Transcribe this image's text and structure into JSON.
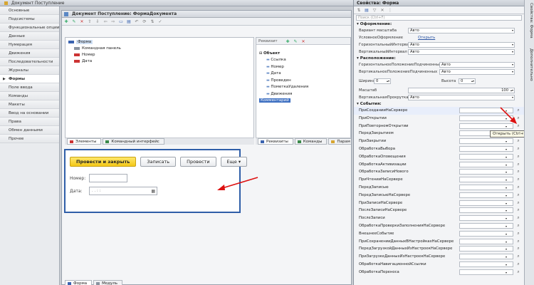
{
  "window_title": "Документ Поступление",
  "nav_items": [
    "Основные",
    "Подсистемы",
    "Функциональные опции",
    "Данные",
    "Нумерация",
    "Движения",
    "Последовательности",
    "Журналы",
    "Формы",
    "Поле ввода",
    "Команды",
    "Макеты",
    "Ввод на основании",
    "Права",
    "Обмен данными",
    "Прочее"
  ],
  "nav_active_index": 8,
  "doc_title": "Документ Поступление: ФормаДокумента",
  "tree": {
    "items": [
      {
        "label": "Форма",
        "color": "#3a63b0"
      },
      {
        "label": "Командная панель",
        "color": "#8a93a0"
      },
      {
        "label": "Номер",
        "color": "#cc3333"
      },
      {
        "label": "Дата",
        "color": "#cc3333"
      }
    ]
  },
  "req": {
    "header": "Реквизит",
    "items": [
      {
        "label": "Объект",
        "bold": true,
        "sel": false
      },
      {
        "label": "Ссылка",
        "bold": false,
        "sel": false
      },
      {
        "label": "Номер",
        "bold": false,
        "sel": false
      },
      {
        "label": "Дата",
        "bold": false,
        "sel": false
      },
      {
        "label": "Проведен",
        "bold": false,
        "sel": false
      },
      {
        "label": "ПометкаУдаления",
        "bold": false,
        "sel": false
      },
      {
        "label": "Движения",
        "bold": false,
        "sel": false
      },
      {
        "label": "Комментарий",
        "bold": false,
        "sel": true
      }
    ]
  },
  "tabs_left": [
    "Элементы",
    "Командный интерфейс"
  ],
  "tabs_right": [
    "Реквизиты",
    "Команды",
    "Парам"
  ],
  "preview": {
    "btn_post_close": "Провести и закрыть",
    "btn_save": "Записать",
    "btn_post": "Провести",
    "btn_more": "Еще ▾",
    "label_number": "Номер:",
    "label_date": "Дата:",
    "date_mask": ". .    :  :"
  },
  "bottom_tabs": [
    "Форма",
    "Модуль"
  ],
  "props": {
    "title": "Свойства: Форма",
    "search_placeholder": "Поиск (Ctrl+F)",
    "sec_appearance": "Оформление:",
    "appearance_rows": [
      {
        "label": "Вариант масштаба",
        "value": "Авто"
      },
      {
        "label": "УсловноеОформление",
        "value": "",
        "link": "Открыть"
      },
      {
        "label": "ГоризонтальныйИнтервал",
        "value": "Авто"
      },
      {
        "label": "ВертикальныйИнтервал",
        "value": "Авто"
      }
    ],
    "sec_position": "Расположение:",
    "position_rows": [
      {
        "label": "ГоризонтальноеПоложениеПодчиненных",
        "value": "Авто"
      },
      {
        "label": "ВертикальноеПоложениеПодчиненных",
        "value": "Авто"
      }
    ],
    "width_label": "Ширина",
    "width_value": "0",
    "height_label": "Высота",
    "height_value": "0",
    "scale_label": "Масштаб",
    "scale_value": "100",
    "vscroll_label": "ВертикальнаяПрокрутка",
    "vscroll_value": "Авто",
    "sec_events": "События:",
    "events": [
      "ПриСозданииНаСервере",
      "ПриОткрытии",
      "ПриПовторномОткрытии",
      "ПередЗакрытием",
      "ПриЗакрытии",
      "ОбработкаВыбора",
      "ОбработкаОповещения",
      "ОбработкаАктивизации",
      "ОбработкаЗаписиНового",
      "ПриЧтенииНаСервере",
      "ПередЗаписью",
      "ПередЗаписьюНаСервере",
      "ПриЗаписиНаСервере",
      "ПослеЗаписиНаСервере",
      "ПослеЗаписи",
      "ОбработкаПроверкиЗаполненияНаСервере",
      "ВнешнееСобытие",
      "ПриСохраненииДанныхВНастройкахНаСервере",
      "ПередЗагрузкойДанныхИзНастроекНаСервере",
      "ПриЗагрузкеДанныхИзНастроекНаСервере",
      "ОбработкаНавигационнойСсылки",
      "ОбработкаПереноса"
    ]
  },
  "tooltip": "Открыть (Ctrl+Shift+F4)",
  "side_tabs": [
    "Свойства: Форма",
    "Дополнительно"
  ],
  "accent": "#2f5ea8",
  "arrow_color": "#d11"
}
